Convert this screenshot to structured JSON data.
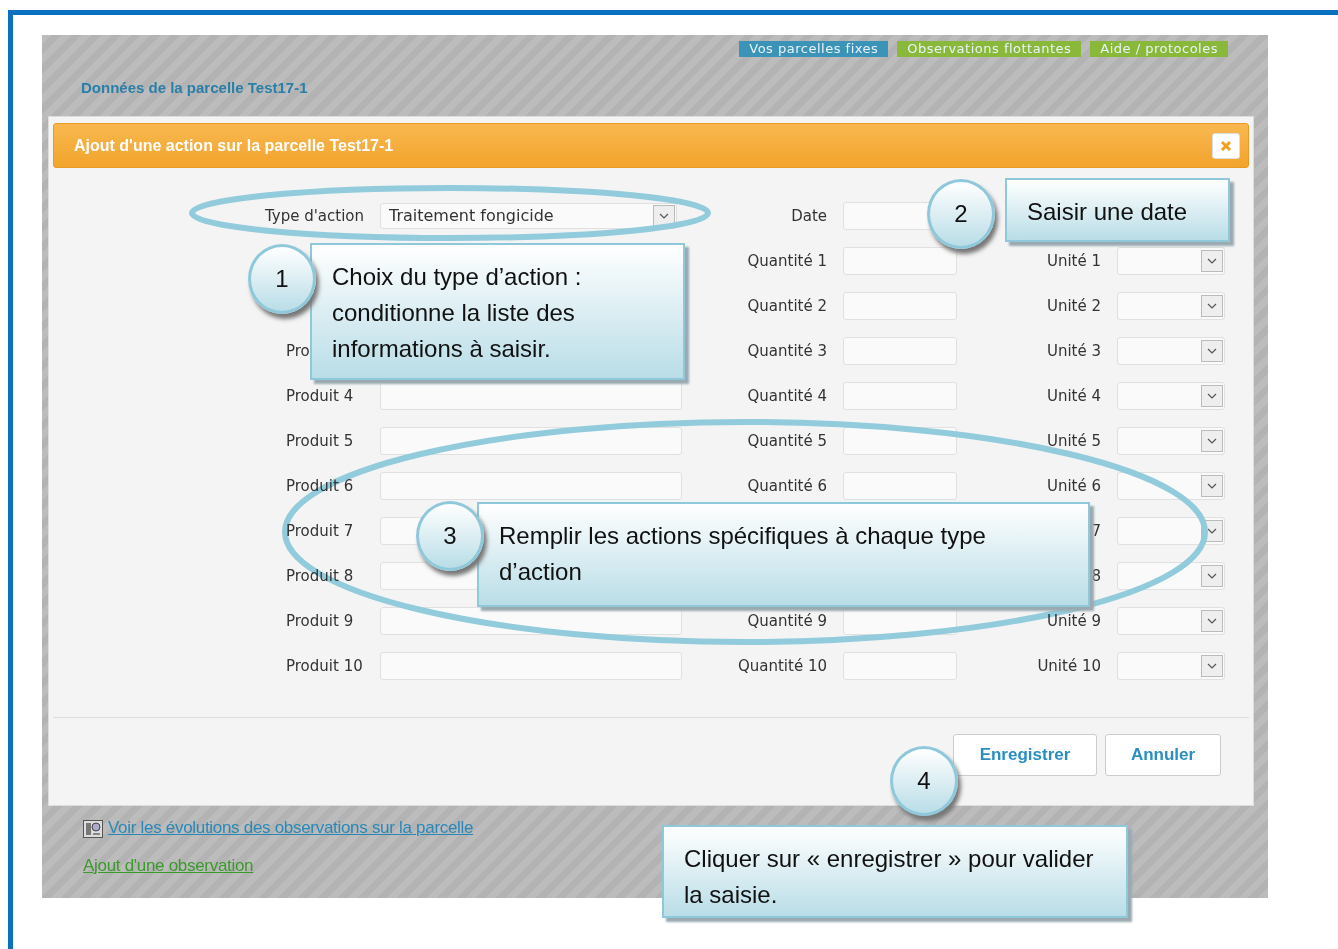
{
  "nav_tabs": [
    {
      "label": "Vos parcelles fixes",
      "color": "#3b93b8"
    },
    {
      "label": "Observations flottantes",
      "color": "#8ab83a"
    },
    {
      "label": "Aide / protocoles",
      "color": "#8ab83a"
    }
  ],
  "page_title": "Données de la parcelle Test17-1",
  "dialog": {
    "title": "Ajout d'une action sur la parcelle Test17-1",
    "type_label": "Type d'action",
    "type_value": "Traitement fongicide",
    "date_label": "Date",
    "rows": [
      {
        "quantite": "Quantité 1",
        "unite": "Unité 1"
      },
      {
        "quantite": "Quantité 2",
        "unite": "Unité 2"
      },
      {
        "produit": "Pro",
        "quantite": "Quantité 3",
        "unite": "Unité 3"
      },
      {
        "produit": "Produit 4",
        "quantite": "Quantité 4",
        "unite": "Unité 4"
      },
      {
        "produit": "Produit 5",
        "quantite": "Quantité 5",
        "unite": "Unité 5"
      },
      {
        "produit": "Produit 6",
        "quantite": "Quantité 6",
        "unite": "Unité 6"
      },
      {
        "produit": "Produit 7",
        "unite": "7"
      },
      {
        "produit": "Produit 8",
        "unite": "8"
      },
      {
        "produit": "Produit 9",
        "quantite": "Quantité 9",
        "unite": "Unité 9"
      },
      {
        "produit": "Produit 10",
        "quantite": "Quantité 10",
        "unite": "Unité 10"
      }
    ],
    "buttons": [
      "Enregistrer",
      "Annuler"
    ]
  },
  "links": [
    {
      "label": "Voir les évolutions des observations sur la parcelle",
      "kind": "icon"
    },
    {
      "label": "Ajout d'une observation",
      "kind": "plain"
    }
  ],
  "callouts": [
    {
      "number": "1",
      "text": "Choix du type d’action : conditionne la liste des informations à saisir."
    },
    {
      "number": "2",
      "text": "Saisir une date"
    },
    {
      "number": "3",
      "text": "Remplir les actions spécifiques à chaque type d’action"
    },
    {
      "number": "4",
      "text": "Cliquer sur « enregistrer »  pour valider la saisie."
    }
  ]
}
